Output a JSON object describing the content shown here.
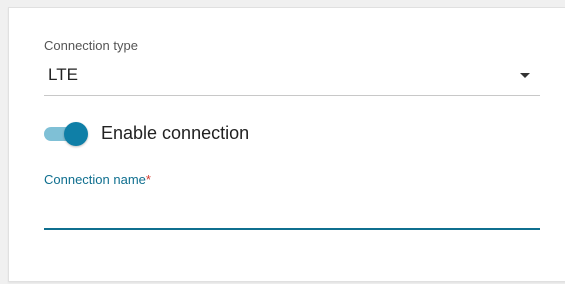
{
  "connection_type": {
    "label": "Connection type",
    "value": "LTE",
    "caret_icon": "caret-down-icon"
  },
  "enable_connection": {
    "label": "Enable connection",
    "checked": true,
    "colors": {
      "track": "#7fc0d6",
      "thumb": "#0f7fa7"
    }
  },
  "connection_name": {
    "label": "Connection name",
    "required_marker": "*",
    "value": "",
    "placeholder": ""
  },
  "colors": {
    "accent": "#0f6f8f",
    "required": "#d23c2f"
  }
}
